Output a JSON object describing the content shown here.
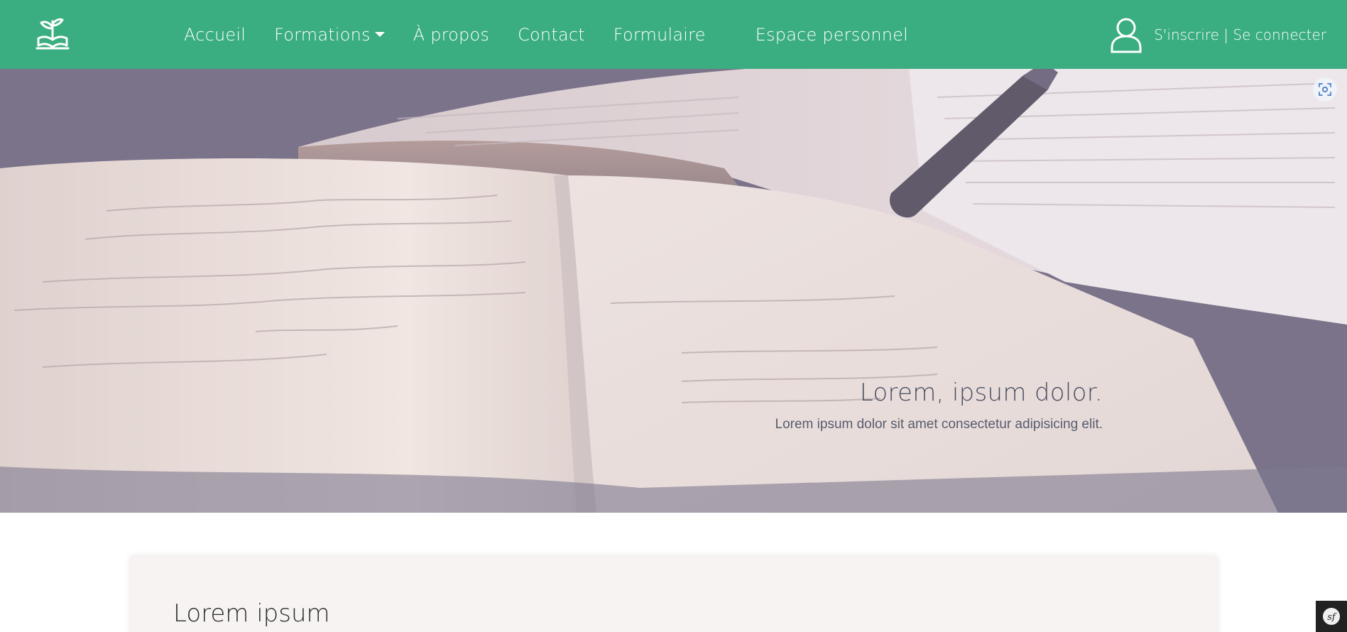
{
  "nav": {
    "logo_icon": "plant-book-logo-icon",
    "links": [
      {
        "label": "Accueil"
      },
      {
        "label": "Formations"
      },
      {
        "label": "À propos"
      },
      {
        "label": "Contact"
      },
      {
        "label": "Formulaire"
      },
      {
        "label": "Espace personnel"
      }
    ],
    "user_icon": "user-icon",
    "signup": "S'inscrire",
    "separator": " | ",
    "login": "Se connecter"
  },
  "hero": {
    "title": "Lorem, ipsum dolor.",
    "subtitle": "Lorem ipsum dolor sit amet consectetur adipisicing elit.",
    "scan_icon": "screen-capture-icon"
  },
  "card": {
    "title": "Lorem ipsum"
  },
  "badge": {
    "icon": "symfony-toolbar-icon"
  },
  "colors": {
    "nav_bg": "#3aae80",
    "nav_text": "#ffffff",
    "card_bg": "#f7f3f3"
  }
}
